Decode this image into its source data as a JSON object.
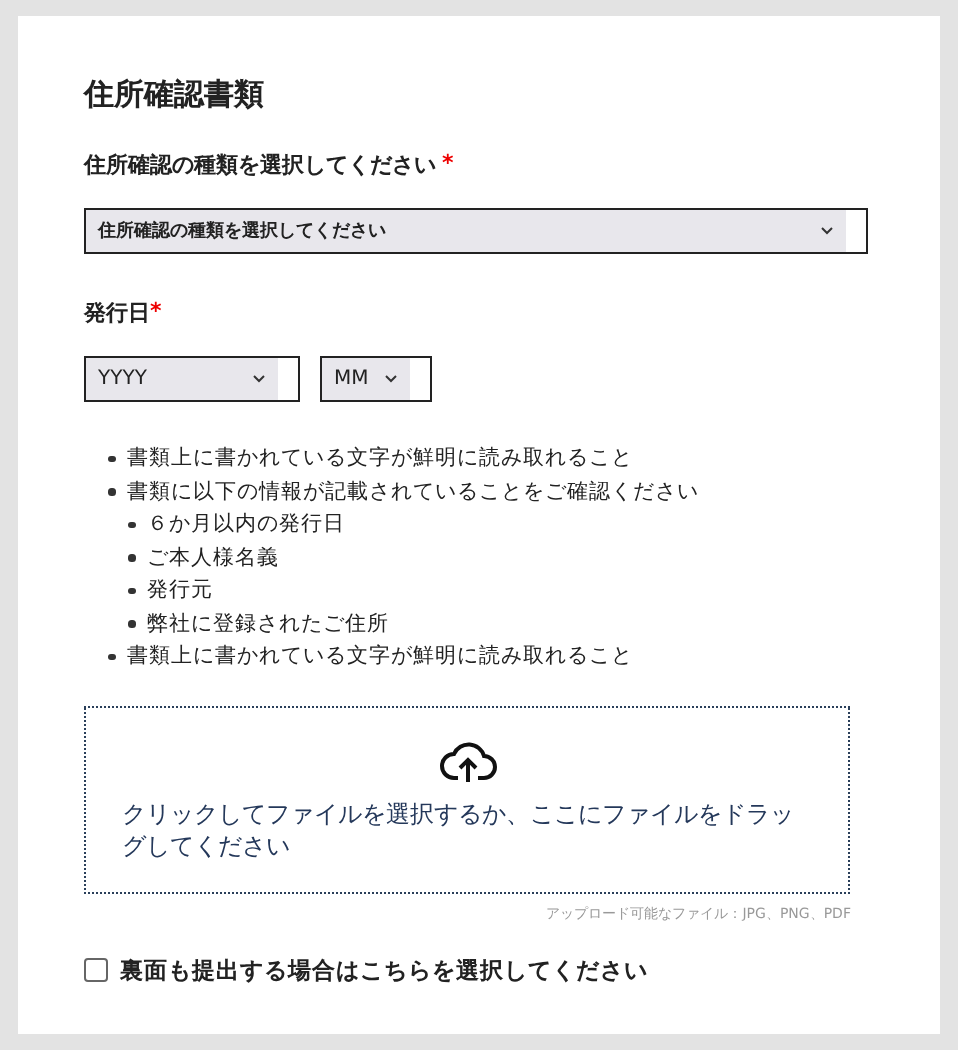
{
  "title": "住所確認書類",
  "doc_type": {
    "label": "住所確認の種類を選択してください",
    "required_mark": "*",
    "value": "住所確認の種類を選択してください"
  },
  "issue_date": {
    "label": "発行日",
    "required_mark": "*",
    "selects": [
      {
        "value": "YYYY"
      },
      {
        "value": "MM"
      }
    ]
  },
  "requirements": [
    {
      "text": "書類上に書かれている文字が鮮明に読み取れること"
    },
    {
      "text": "書類に以下の情報が記載されていることをご確認ください",
      "children": [
        {
          "text": "６か月以内の発行日"
        },
        {
          "text": "ご本人様名義"
        },
        {
          "text": "発行元"
        },
        {
          "text": "弊社に登録されたご住所"
        }
      ]
    },
    {
      "text": "書類上に書かれている文字が鮮明に読み取れること"
    }
  ],
  "upload": {
    "prompt": "クリックしてファイルを選択するか、ここにファイルをドラッグしてください",
    "file_types": "アップロード可能なファイル：JPG、PNG、PDF"
  },
  "back_side": {
    "label": "裏面も提出する場合はこちらを選択してください",
    "checked": false
  }
}
